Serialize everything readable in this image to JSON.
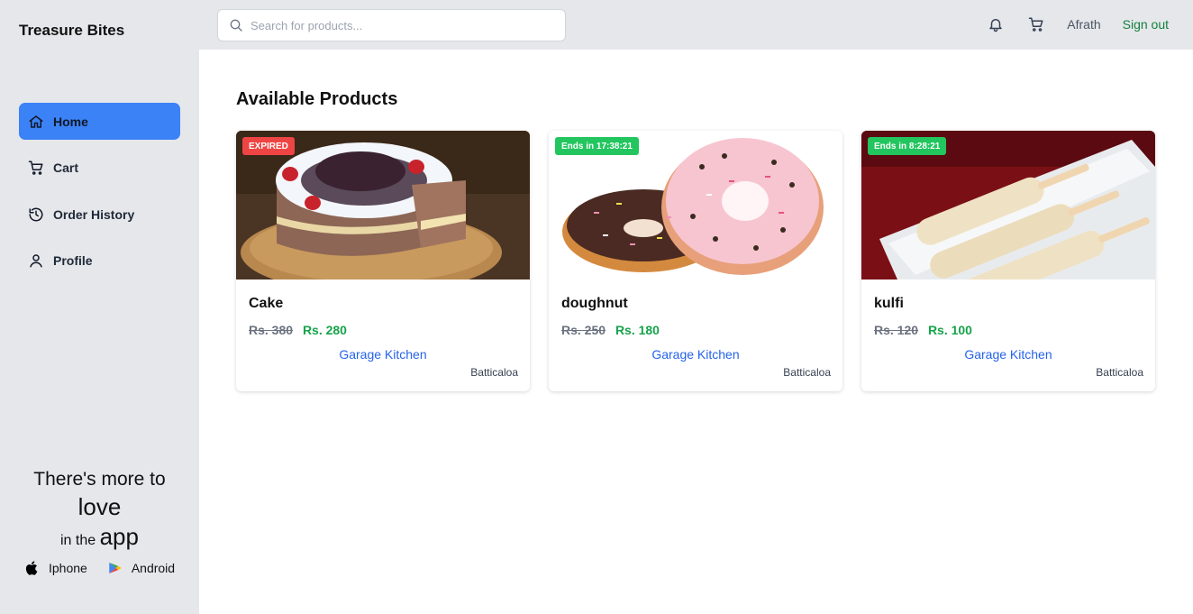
{
  "brand": "Treasure Bites",
  "nav": [
    {
      "label": "Home",
      "icon": "home-icon",
      "active": true
    },
    {
      "label": "Cart",
      "icon": "cart-icon"
    },
    {
      "label": "Order History",
      "icon": "history-icon"
    },
    {
      "label": "Profile",
      "icon": "user-icon"
    }
  ],
  "promo": {
    "line1": "There's more to",
    "line2": "love",
    "line3_small": "in the",
    "line3_big": "app"
  },
  "stores": {
    "iphone": "Iphone",
    "android": "Android"
  },
  "search": {
    "placeholder": "Search for products..."
  },
  "header": {
    "user": "Afrath",
    "signout": "Sign out"
  },
  "page_title": "Available Products",
  "products": [
    {
      "name": "Cake",
      "old_price": "Rs. 380",
      "new_price": "Rs. 280",
      "seller": "Garage Kitchen",
      "location": "Batticaloa",
      "badge": "EXPIRED",
      "badge_color": "#ef4444"
    },
    {
      "name": "doughnut",
      "old_price": "Rs. 250",
      "new_price": "Rs. 180",
      "seller": "Garage Kitchen",
      "location": "Batticaloa",
      "badge": "Ends in 17:38:21",
      "badge_color": "#22c55e"
    },
    {
      "name": "kulfi",
      "old_price": "Rs. 120",
      "new_price": "Rs. 100",
      "seller": "Garage Kitchen",
      "location": "Batticaloa",
      "badge": "Ends in 8:28:21",
      "badge_color": "#22c55e"
    }
  ],
  "colors": {
    "accent": "#3b82f6",
    "price": "#16a34a",
    "seller": "#2563eb",
    "signout": "#15803d",
    "sidebar": "#e5e7eb"
  }
}
